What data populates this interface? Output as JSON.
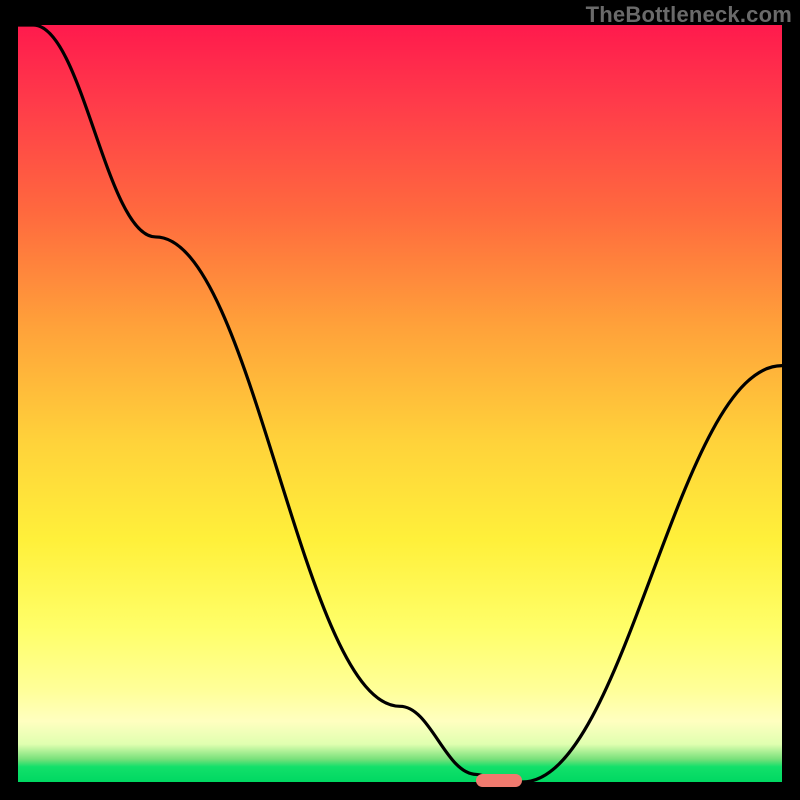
{
  "watermark": "TheBottleneck.com",
  "chart_data": {
    "type": "line",
    "title": "",
    "xlabel": "",
    "ylabel": "",
    "xlim": [
      0,
      100
    ],
    "ylim": [
      0,
      100
    ],
    "x": [
      0,
      2,
      18,
      50,
      60,
      63,
      66,
      100
    ],
    "values": [
      100,
      100,
      72,
      10,
      1,
      0,
      0,
      55
    ],
    "marker": {
      "x_start": 60,
      "x_end": 66,
      "y": 0
    },
    "gradient_stops": [
      {
        "pct": 0,
        "color": "#ff1a4d"
      },
      {
        "pct": 55,
        "color": "#ffd23a"
      },
      {
        "pct": 88,
        "color": "#ffff9a"
      },
      {
        "pct": 100,
        "color": "#00d862"
      }
    ]
  }
}
